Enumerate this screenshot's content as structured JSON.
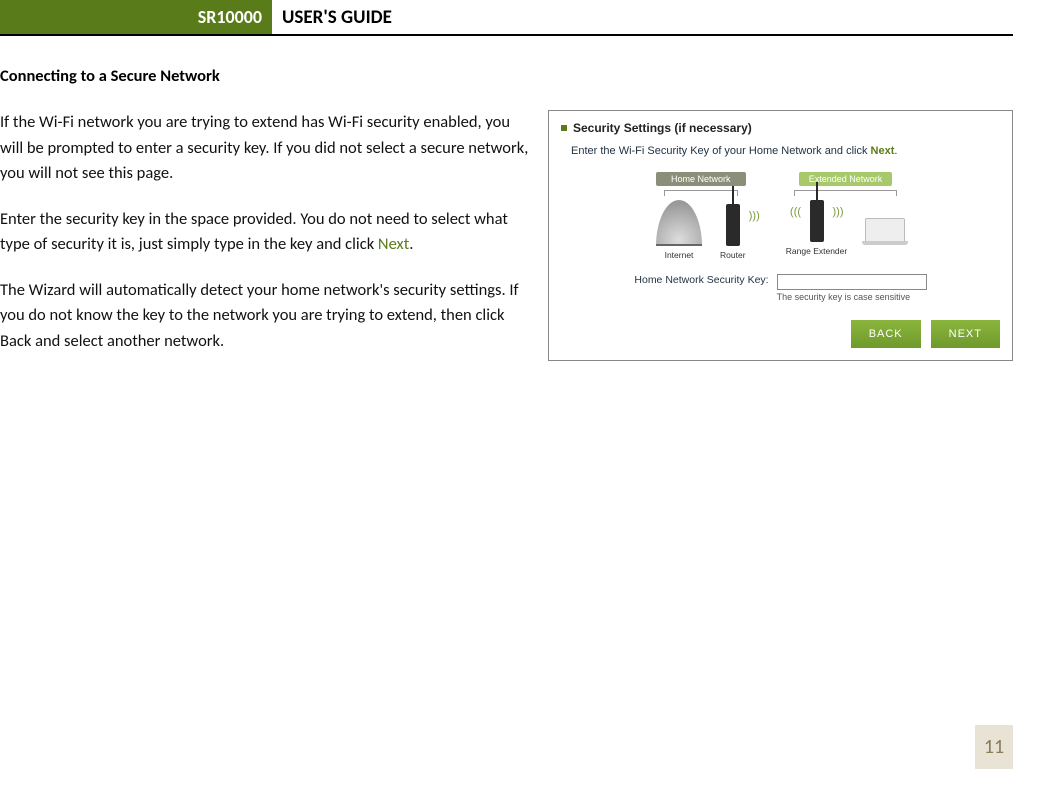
{
  "header": {
    "model": "SR10000",
    "title": "USER'S GUIDE"
  },
  "section_heading": "Connecting to a Secure Network",
  "paragraphs": {
    "p1": "If the Wi-Fi network you are trying to extend has Wi-Fi security enabled, you will be prompted to enter a security key.  If you did not select a secure network, you will not see this page.",
    "p2_a": "Enter the security key in the space provided.  You do not need to select what type of security it is, just simply type in the key and click ",
    "p2_next": "Next",
    "p2_b": ".",
    "p3": "The Wizard will automatically detect your home network's security settings. If you do not know the key to the network you are trying to extend, then click Back and select another network."
  },
  "figure": {
    "title": "Security Settings (if necessary)",
    "sub_a": "Enter the Wi-Fi Security Key of your Home Network and click ",
    "sub_next": "Next",
    "sub_b": ".",
    "home_label": "Home Network",
    "ext_label": "Extended Network",
    "dev_internet": "Internet",
    "dev_router": "Router",
    "dev_extender": "Range Extender",
    "key_label": "Home Network Security Key:",
    "key_note": "The security key is case sensitive",
    "btn_back": "BACK",
    "btn_next": "NEXT"
  },
  "page_number": "11"
}
